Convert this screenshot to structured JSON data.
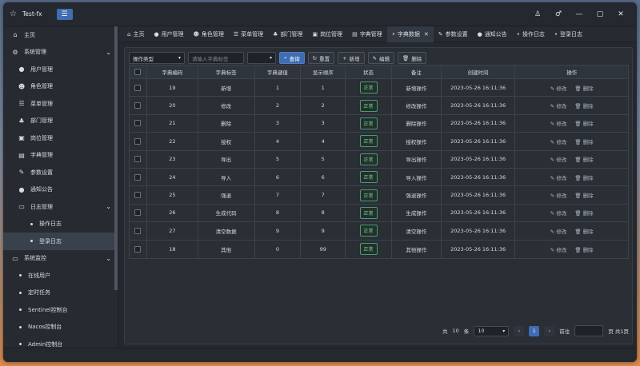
{
  "window": {
    "title": "Test-fx",
    "controls": [
      "shirt-icon",
      "user-icon",
      "minimize-icon",
      "maximize-icon",
      "close-icon"
    ]
  },
  "sidebar": {
    "items": [
      {
        "label": "主页",
        "icon": "home-icon",
        "level": 0
      },
      {
        "label": "系统管理",
        "icon": "gear-icon",
        "level": 0,
        "expanded": true
      },
      {
        "label": "用户管理",
        "icon": "user-icon",
        "level": 1
      },
      {
        "label": "角色管理",
        "icon": "users-icon",
        "level": 1
      },
      {
        "label": "菜单管理",
        "icon": "list-icon",
        "level": 1
      },
      {
        "label": "部门管理",
        "icon": "org-icon",
        "level": 1
      },
      {
        "label": "岗位管理",
        "icon": "badge-icon",
        "level": 1
      },
      {
        "label": "字典管理",
        "icon": "dict-icon",
        "level": 1
      },
      {
        "label": "参数设置",
        "icon": "edit-icon",
        "level": 1
      },
      {
        "label": "通知公告",
        "icon": "chat-icon",
        "level": 1
      },
      {
        "label": "日志管理",
        "icon": "log-icon",
        "level": 1,
        "expanded": true
      },
      {
        "label": "操作日志",
        "level": 2
      },
      {
        "label": "登录日志",
        "level": 2,
        "active": true
      },
      {
        "label": "系统监控",
        "icon": "monitor-icon",
        "level": 0,
        "expanded": true
      },
      {
        "label": "在线用户",
        "level": 2
      },
      {
        "label": "定时任务",
        "level": 2
      },
      {
        "label": "Sentinel控制台",
        "level": 2
      },
      {
        "label": "Nacos控制台",
        "level": 2
      },
      {
        "label": "Admin控制台",
        "level": 2
      }
    ]
  },
  "tabs": [
    {
      "label": "主页",
      "icon": "home-icon"
    },
    {
      "label": "用户管理",
      "icon": "user-icon"
    },
    {
      "label": "角色管理",
      "icon": "users-icon"
    },
    {
      "label": "菜单管理",
      "icon": "list-icon"
    },
    {
      "label": "部门管理",
      "icon": "org-icon"
    },
    {
      "label": "岗位管理",
      "icon": "badge-icon"
    },
    {
      "label": "字典管理",
      "icon": "dict-icon"
    },
    {
      "label": "字典数据",
      "icon": "dot",
      "active": true,
      "closable": true
    },
    {
      "label": "参数设置",
      "icon": "edit-icon"
    },
    {
      "label": "通知公告",
      "icon": "chat-icon"
    },
    {
      "label": "操作日志",
      "icon": "dot"
    },
    {
      "label": "登录日志",
      "icon": "dot"
    }
  ],
  "toolbar": {
    "type_select": "操作类型",
    "label_placeholder": "请输入字典标签",
    "status_select": "",
    "search": "查询",
    "reset": "重置",
    "add": "新增",
    "edit": "编辑",
    "delete": "删除"
  },
  "table": {
    "headers": [
      "",
      "字典编码",
      "字典标签",
      "字典键值",
      "显示顺序",
      "状态",
      "备注",
      "创建时间",
      "操作"
    ],
    "rows": [
      {
        "code": "19",
        "label": "新增",
        "value": "1",
        "order": "1",
        "status": "正常",
        "remark": "新增操作",
        "created": "2023-05-26 16:11:36"
      },
      {
        "code": "20",
        "label": "修改",
        "value": "2",
        "order": "2",
        "status": "正常",
        "remark": "修改操作",
        "created": "2023-05-26 16:11:36"
      },
      {
        "code": "21",
        "label": "删除",
        "value": "3",
        "order": "3",
        "status": "正常",
        "remark": "删除操作",
        "created": "2023-05-26 16:11:36"
      },
      {
        "code": "22",
        "label": "授权",
        "value": "4",
        "order": "4",
        "status": "正常",
        "remark": "授权操作",
        "created": "2023-05-26 16:11:36"
      },
      {
        "code": "23",
        "label": "导出",
        "value": "5",
        "order": "5",
        "status": "正常",
        "remark": "导出操作",
        "created": "2023-05-26 16:11:36"
      },
      {
        "code": "24",
        "label": "导入",
        "value": "6",
        "order": "6",
        "status": "正常",
        "remark": "导入操作",
        "created": "2023-05-26 16:11:36"
      },
      {
        "code": "25",
        "label": "强退",
        "value": "7",
        "order": "7",
        "status": "正常",
        "remark": "强退操作",
        "created": "2023-05-26 16:11:36"
      },
      {
        "code": "26",
        "label": "生成代码",
        "value": "8",
        "order": "8",
        "status": "正常",
        "remark": "生成操作",
        "created": "2023-05-26 16:11:36"
      },
      {
        "code": "27",
        "label": "清空数据",
        "value": "9",
        "order": "9",
        "status": "正常",
        "remark": "清空操作",
        "created": "2023-05-26 16:11:36"
      },
      {
        "code": "18",
        "label": "其他",
        "value": "0",
        "order": "99",
        "status": "正常",
        "remark": "其他操作",
        "created": "2023-05-26 16:11:36"
      }
    ],
    "edit_label": "修改",
    "delete_label": "删除"
  },
  "pager": {
    "total_prefix": "共",
    "total": "10",
    "total_suffix": "条",
    "page_size": "10",
    "current": "1",
    "goto": "前往",
    "pages_text": "页 共1页"
  },
  "colors": {
    "accent": "#3e6db4",
    "status_green": "#7ad0a8",
    "background": "#25292f"
  }
}
